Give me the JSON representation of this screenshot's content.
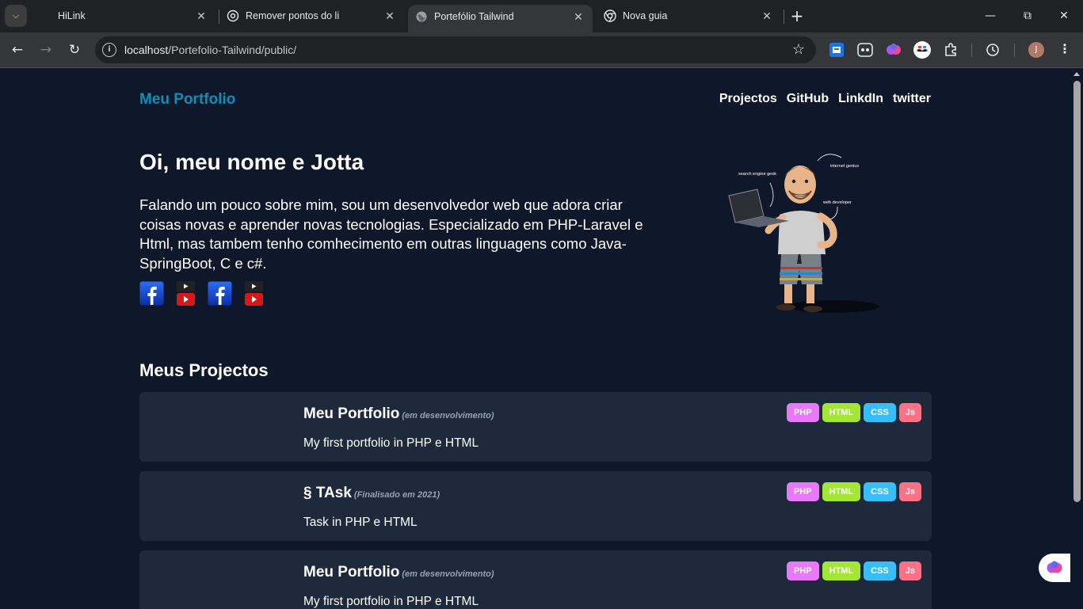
{
  "browser": {
    "tabs": [
      {
        "title": "HiLink",
        "active": false,
        "favicon": "none"
      },
      {
        "title": "Remover pontos do li",
        "active": false,
        "favicon": "chatgpt-icon"
      },
      {
        "title": "Portefólio Tailwind",
        "active": true,
        "favicon": "globe-icon"
      },
      {
        "title": "Nova guia",
        "active": false,
        "favicon": "chrome-icon"
      }
    ],
    "address": {
      "host": "localhost",
      "path": "/Portefolio-Tailwind/public/"
    },
    "profile_initial": "J",
    "colors": {
      "tabstrip": "#202124",
      "toolbar": "#35363a"
    }
  },
  "page": {
    "brand": "Meu Portfolio",
    "nav": [
      "Projectos",
      "GitHub",
      "LinkdIn",
      "twitter"
    ],
    "hero": {
      "title": "Oi, meu nome e Jotta",
      "text": "Falando um pouco sobre mim, sou um desenvolvedor web que adora criar coisas novas e aprender novas tecnologias. Especializado em PHP-Laravel e Html, mas tambem tenho comhecimento em outras linguagens como Java-SpringBoot, C e c#.",
      "socials": [
        "facebook-icon",
        "youtube-icon",
        "facebook-icon",
        "youtube-icon"
      ],
      "illustration_labels": [
        "search engine geek",
        "internet genius",
        "web developer"
      ]
    },
    "projects_title": "Meus Projectos",
    "projects": [
      {
        "title": "Meu Portfolio",
        "status": "(em desenvolvimento)",
        "description": "My first portfolio in PHP e HTML",
        "tags": [
          "PHP",
          "HTML",
          "CSS",
          "Js"
        ]
      },
      {
        "title": "§ TAsk",
        "status": "(Finalisado em 2021)",
        "description": "Task in PHP e HTML",
        "tags": [
          "PHP",
          "HTML",
          "CSS",
          "Js"
        ]
      },
      {
        "title": "Meu Portfolio",
        "status": "(em desenvolvimento)",
        "description": "My first portfolio in PHP e HTML",
        "tags": [
          "PHP",
          "HTML",
          "CSS",
          "Js"
        ]
      }
    ],
    "colors": {
      "background": "#0f172a",
      "card": "#1e293b",
      "brand": "#0e8fb8",
      "tag_php": "#e879f9",
      "tag_html": "#a3e635",
      "tag_css": "#38bdf8",
      "tag_js": "#fb7185"
    }
  }
}
